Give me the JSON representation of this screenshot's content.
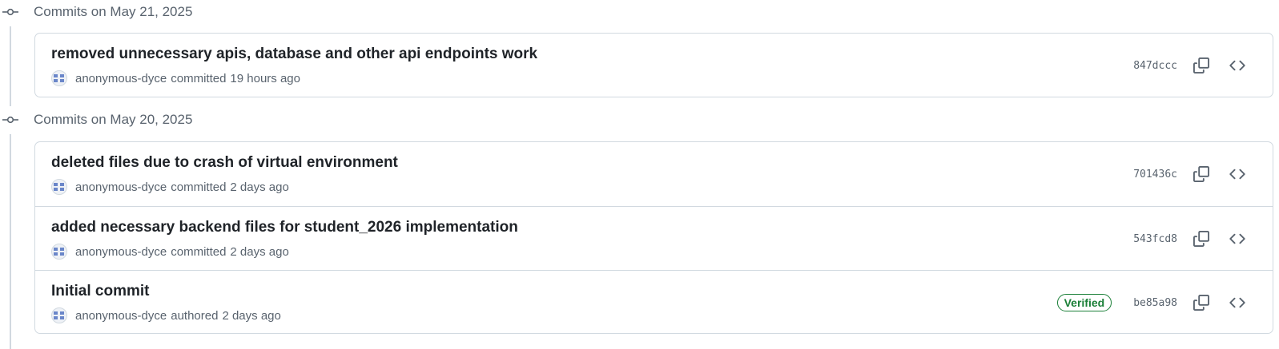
{
  "colors": {
    "border": "#d1d9e0",
    "muted_text": "#59636e",
    "primary_text": "#1f2328",
    "verified_green": "#1a7f37",
    "avatar_pattern": "#6a86c9"
  },
  "groups": [
    {
      "title": "Commits on May 21, 2025",
      "commits": [
        {
          "message": "removed unnecessary apis, database and other api endpoints work",
          "author": "anonymous-dyce",
          "verb": "committed",
          "time": "19 hours ago",
          "verified_label": "",
          "sha": "847dccc",
          "icons": [
            "copy-icon",
            "code-icon"
          ]
        }
      ]
    },
    {
      "title": "Commits on May 20, 2025",
      "commits": [
        {
          "message": "deleted files due to crash of virtual environment",
          "author": "anonymous-dyce",
          "verb": "committed",
          "time": "2 days ago",
          "verified_label": "",
          "sha": "701436c",
          "icons": [
            "copy-icon",
            "code-icon"
          ]
        },
        {
          "message": "added necessary backend files for student_2026 implementation",
          "author": "anonymous-dyce",
          "verb": "committed",
          "time": "2 days ago",
          "verified_label": "",
          "sha": "543fcd8",
          "icons": [
            "copy-icon",
            "code-icon"
          ]
        },
        {
          "message": "Initial commit",
          "author": "anonymous-dyce",
          "verb": "authored",
          "time": "2 days ago",
          "verified_label": "Verified",
          "sha": "be85a98",
          "icons": [
            "copy-icon",
            "code-icon"
          ]
        }
      ]
    }
  ]
}
